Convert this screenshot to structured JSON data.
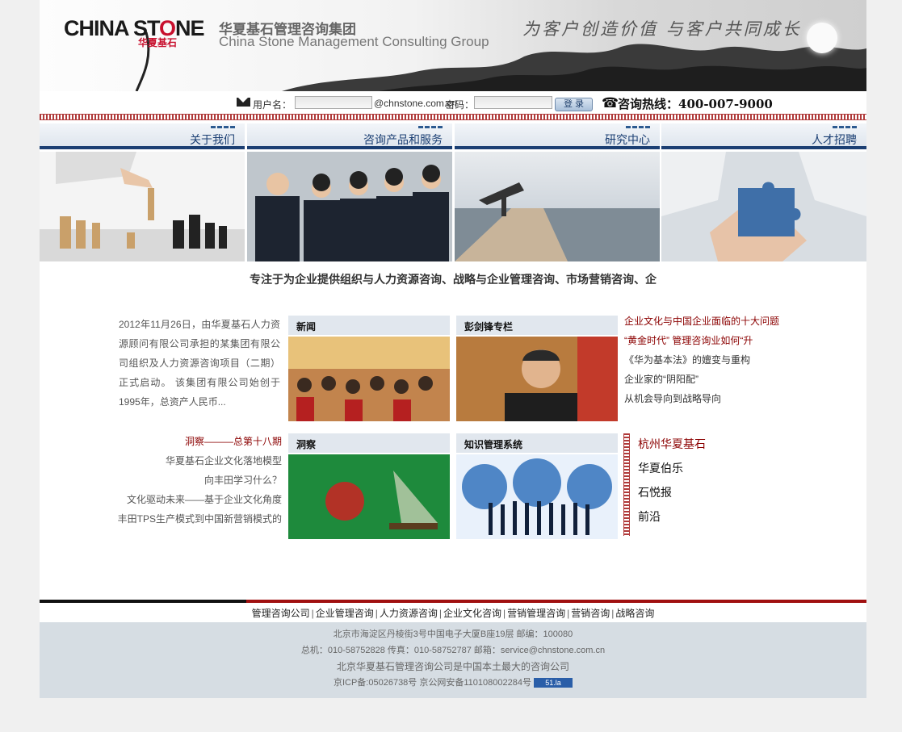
{
  "header": {
    "logo_main": "CHINA ST",
    "logo_o": "O",
    "logo_end": "NE",
    "logo_sub": "华夏基石",
    "brand_cn": "华夏基石管理咨询集团",
    "brand_en": "China Stone Management Consulting Group",
    "slogan": "为客户创造价值  与客户共同成长"
  },
  "login": {
    "user_label": "用户名：",
    "domain": "@chnstone.com.cn",
    "pwd_label": "密码：",
    "button": "登 录",
    "hotline_label": "咨询热线：",
    "hotline_number": "400-007-9000"
  },
  "tiles": [
    {
      "label": "关于我们"
    },
    {
      "label": "咨询产品和服务"
    },
    {
      "label": "研究中心"
    },
    {
      "label": "人才招聘"
    }
  ],
  "tagline": "专注于为企业提供组织与人力资源咨询、战略与企业管理咨询、市场营销咨询、企",
  "news_text": "2012年11月26日，由华夏基石人力资源顾问有限公司承担的某集团有限公司组织及人力资源咨询项目（二期）正式启动。 该集团有限公司始创于1995年，总资产人民币...",
  "panels": [
    {
      "title": "新闻"
    },
    {
      "title": "彭剑锋专栏"
    },
    {
      "title": "洞察"
    },
    {
      "title": "知识管理系统"
    }
  ],
  "column_list": [
    "企业文化与中国企业面临的十大问题",
    "“黄金时代” 管理咨询业如何“升",
    "《华为基本法》的嬗变与重构",
    "企业家的“阴阳配”",
    "从机会导向到战略导向"
  ],
  "insight_list": [
    "洞察———总第十八期",
    "华夏基石企业文化落地模型",
    "向丰田学习什么？",
    "文化驱动未来——基于企业文化角度",
    "丰田TPS生产模式到中国新营销模式的"
  ],
  "links": [
    "杭州华夏基石",
    "华夏伯乐",
    "石悦报",
    "前沿"
  ],
  "footer": {
    "links": [
      "管理咨询公司",
      "企业管理咨询",
      "人力资源咨询",
      "企业文化咨询",
      "营销管理咨询",
      "营销咨询",
      "战略咨询"
    ],
    "address": "北京市海淀区丹棱街3号中国电子大厦B座19层  邮编：100080",
    "contact": "总机：010-58752828  传真：010-58752787  邮箱：service@chnstone.com.cn",
    "statement": "北京华夏基石管理咨询公司是中国本土最大的咨询公司",
    "icp": "京ICP备:05026738号  京公网安备110108002284号",
    "badge": "51.la"
  }
}
